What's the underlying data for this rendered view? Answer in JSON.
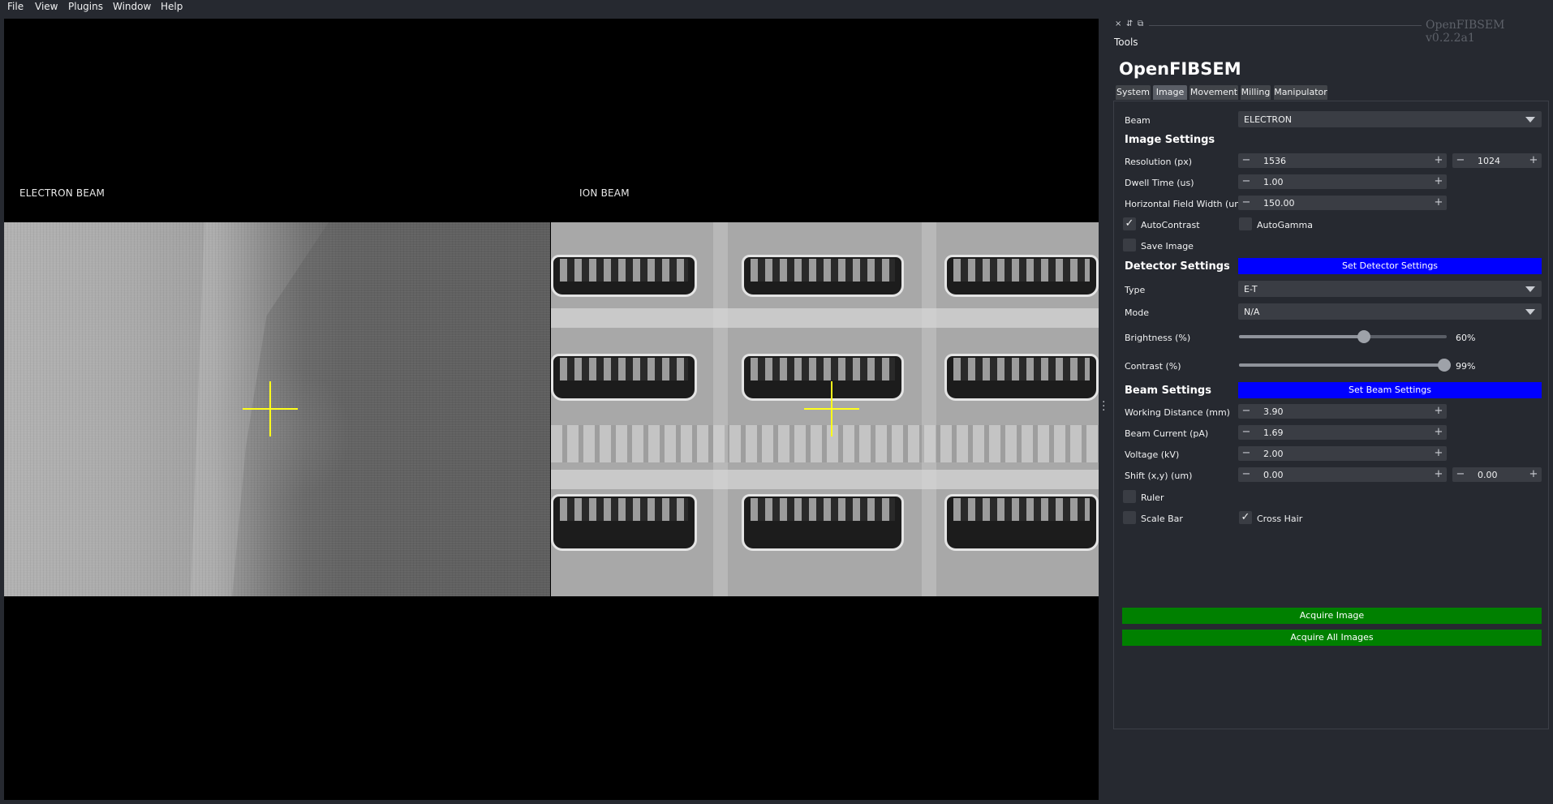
{
  "menu": [
    "File",
    "View",
    "Plugins",
    "Window",
    "Help"
  ],
  "viewer": {
    "electron_label": "ELECTRON BEAM",
    "ion_label": "ION BEAM"
  },
  "dock": {
    "plugin_version": "OpenFIBSEM v0.2.2a1",
    "tools_label": "Tools",
    "controls": [
      "×",
      "⇵",
      "⧉"
    ]
  },
  "app": {
    "title": "OpenFIBSEM",
    "tabs": [
      "System",
      "Image",
      "Movement",
      "Milling",
      "Manipulator"
    ],
    "active_tab": "Image"
  },
  "beam": {
    "label": "Beam",
    "value": "ELECTRON"
  },
  "image_settings": {
    "heading": "Image Settings",
    "resolution": {
      "label": "Resolution (px)",
      "x": "1536",
      "y": "1024"
    },
    "dwell_time": {
      "label": "Dwell Time (us)",
      "value": "1.00"
    },
    "hfw": {
      "label": "Horizontal Field Width (um)",
      "value": "150.00"
    },
    "autocontrast": {
      "label": "AutoContrast",
      "checked": true
    },
    "autogamma": {
      "label": "AutoGamma",
      "checked": false
    },
    "save_image": {
      "label": "Save Image",
      "checked": false
    }
  },
  "detector_settings": {
    "heading": "Detector Settings",
    "button": "Set Detector Settings",
    "type": {
      "label": "Type",
      "value": "E-T"
    },
    "mode": {
      "label": "Mode",
      "value": "N/A"
    },
    "brightness": {
      "label": "Brightness (%)",
      "value": 60,
      "display": "60%"
    },
    "contrast": {
      "label": "Contrast (%)",
      "value": 99,
      "display": "99%"
    }
  },
  "beam_settings": {
    "heading": "Beam Settings",
    "button": "Set Beam Settings",
    "working_distance": {
      "label": "Working Distance (mm)",
      "value": "3.90"
    },
    "beam_current": {
      "label": "Beam Current (pA)",
      "value": "1.69"
    },
    "voltage": {
      "label": "Voltage (kV)",
      "value": "2.00"
    },
    "shift": {
      "label": "Shift (x,y) (um)",
      "x": "0.00",
      "y": "0.00"
    },
    "ruler": {
      "label": "Ruler",
      "checked": false
    },
    "scale_bar": {
      "label": "Scale Bar",
      "checked": false
    },
    "cross_hair": {
      "label": "Cross Hair",
      "checked": true
    }
  },
  "actions": {
    "acquire_image": "Acquire Image",
    "acquire_all": "Acquire All Images"
  },
  "spin_symbols": {
    "minus": "−",
    "plus": "+"
  },
  "colors": {
    "background": "#262930",
    "blue_button": "#0000ff",
    "green_button": "#008000",
    "crosshair": "#ffff1a"
  }
}
